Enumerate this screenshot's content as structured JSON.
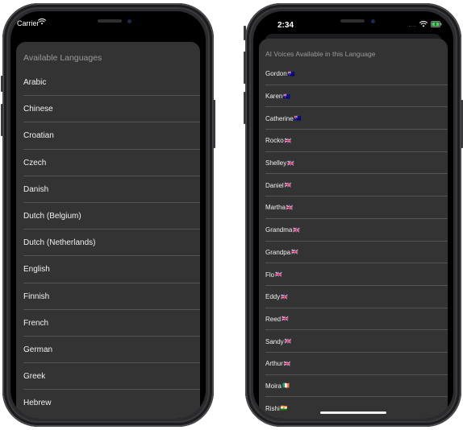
{
  "left_phone": {
    "status_bar": {
      "carrier": "Carrier",
      "wifi_icon": "wifi-icon"
    },
    "header": "Available Languages",
    "languages": [
      "Arabic",
      "Chinese",
      "Croatian",
      "Czech",
      "Danish",
      "Dutch (Belgium)",
      "Dutch (Netherlands)",
      "English",
      "Finnish",
      "French",
      "German",
      "Greek",
      "Hebrew"
    ]
  },
  "right_phone": {
    "status_bar": {
      "time": "2:34",
      "signal": "....",
      "wifi_icon": "wifi-icon",
      "battery_icon": "battery-charging-icon",
      "battery_color": "#4cd964"
    },
    "header": "AI Voices Available in this Language",
    "voices": [
      {
        "name": "Gordon",
        "flag": "🇦🇺"
      },
      {
        "name": "Karen",
        "flag": "🇦🇺"
      },
      {
        "name": "Catherine",
        "flag": "🇦🇺"
      },
      {
        "name": "Rocko",
        "flag": "🇬🇧"
      },
      {
        "name": "Shelley",
        "flag": "🇬🇧"
      },
      {
        "name": "Daniel",
        "flag": "🇬🇧"
      },
      {
        "name": "Martha",
        "flag": "🇬🇧"
      },
      {
        "name": "Grandma",
        "flag": "🇬🇧"
      },
      {
        "name": "Grandpa",
        "flag": "🇬🇧"
      },
      {
        "name": "Flo",
        "flag": "🇬🇧"
      },
      {
        "name": "Eddy",
        "flag": "🇬🇧"
      },
      {
        "name": "Reed",
        "flag": "🇬🇧"
      },
      {
        "name": "Sandy",
        "flag": "🇬🇧"
      },
      {
        "name": "Arthur",
        "flag": "🇬🇧"
      },
      {
        "name": "Moira",
        "flag": "🇮🇪"
      },
      {
        "name": "Rishi",
        "flag": "🇮🇳"
      }
    ]
  }
}
